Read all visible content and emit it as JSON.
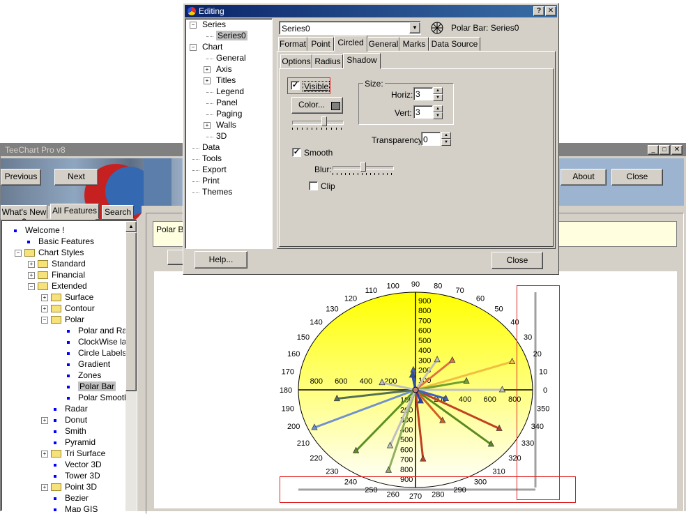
{
  "main_window": {
    "title": "TeeChart Pro v8",
    "buttons": {
      "previous": "Previous",
      "next": "Next",
      "about": "About",
      "close": "Close"
    },
    "tabs": [
      "What's New ?",
      "All Features",
      "Search"
    ],
    "tree": [
      {
        "label": "Welcome !",
        "type": "dot",
        "level": 0
      },
      {
        "label": "Basic Features",
        "type": "dot",
        "level": 1
      },
      {
        "label": "Chart Styles",
        "type": "folder",
        "level": 1,
        "pm": "-"
      },
      {
        "label": "Standard",
        "type": "folder",
        "level": 2,
        "pm": "+"
      },
      {
        "label": "Financial",
        "type": "folder",
        "level": 2,
        "pm": "+"
      },
      {
        "label": "Extended",
        "type": "folder",
        "level": 2,
        "pm": "-"
      },
      {
        "label": "Surface",
        "type": "folder",
        "level": 3,
        "pm": "+"
      },
      {
        "label": "Contour",
        "type": "folder",
        "level": 3,
        "pm": "+"
      },
      {
        "label": "Polar",
        "type": "folder",
        "level": 3,
        "pm": "-"
      },
      {
        "label": "Polar and Radar T",
        "type": "dot",
        "level": 4
      },
      {
        "label": "ClockWise labels",
        "type": "dot",
        "level": 4
      },
      {
        "label": "Circle Labels inside",
        "type": "dot",
        "level": 4
      },
      {
        "label": "Gradient",
        "type": "dot",
        "level": 4
      },
      {
        "label": "Zones",
        "type": "dot",
        "level": 4
      },
      {
        "label": "Polar Bar",
        "type": "dot",
        "level": 4,
        "selected": true
      },
      {
        "label": "Polar Smooth",
        "type": "dot",
        "level": 4
      },
      {
        "label": "Radar",
        "type": "dot",
        "level": 3
      },
      {
        "label": "Donut",
        "type": "dot",
        "level": 3,
        "pm": "+"
      },
      {
        "label": "Smith",
        "type": "dot",
        "level": 3
      },
      {
        "label": "Pyramid",
        "type": "dot",
        "level": 3
      },
      {
        "label": "Tri Surface",
        "type": "folder",
        "level": 3,
        "pm": "+"
      },
      {
        "label": "Vector 3D",
        "type": "dot",
        "level": 3
      },
      {
        "label": "Tower 3D",
        "type": "dot",
        "level": 3
      },
      {
        "label": "Point 3D",
        "type": "folder",
        "level": 3,
        "pm": "+"
      },
      {
        "label": "Bezier",
        "type": "dot",
        "level": 3
      },
      {
        "label": "Map GIS",
        "type": "dot",
        "level": 3
      }
    ],
    "info_text": "Polar Ba"
  },
  "editing": {
    "title": "Editing",
    "tree": [
      {
        "label": "Series",
        "pm": "-",
        "level": 0
      },
      {
        "label": "Series0",
        "level": 1,
        "selected": true
      },
      {
        "label": "Chart",
        "pm": "-",
        "level": 0
      },
      {
        "label": "General",
        "level": 1
      },
      {
        "label": "Axis",
        "pm": "+",
        "level": 1
      },
      {
        "label": "Titles",
        "pm": "+",
        "level": 1
      },
      {
        "label": "Legend",
        "level": 1
      },
      {
        "label": "Panel",
        "level": 1
      },
      {
        "label": "Paging",
        "level": 1
      },
      {
        "label": "Walls",
        "pm": "+",
        "level": 1
      },
      {
        "label": "3D",
        "level": 1
      },
      {
        "label": "Data",
        "level": 0
      },
      {
        "label": "Tools",
        "level": 0
      },
      {
        "label": "Export",
        "level": 0
      },
      {
        "label": "Print",
        "level": 0
      },
      {
        "label": "Themes",
        "level": 0
      }
    ],
    "series_select": "Series0",
    "series_caption": "Polar Bar: Series0",
    "tabs_row1": [
      "Format",
      "Point",
      "Circled",
      "General",
      "Marks",
      "Data Source"
    ],
    "tabs_row2": [
      "Options",
      "Radius",
      "Shadow"
    ],
    "visible_label": "Visible",
    "visible_checked": true,
    "color_button": "Color...",
    "size_group": "Size:",
    "horiz_label": "Horiz:",
    "horiz_value": "3",
    "vert_label": "Vert:",
    "vert_value": "3",
    "transparency_label": "Transparency:",
    "transparency_value": "0",
    "smooth_label": "Smooth",
    "smooth_checked": true,
    "blur_label": "Blur:",
    "clip_label": "Clip",
    "clip_checked": false,
    "help_button": "Help...",
    "close_button": "Close"
  },
  "colors": {
    "face": "#d4d0c8",
    "titlebar": "#0a246a",
    "chart_fill": "#ffff00",
    "highlight_box": "#e02020"
  }
}
